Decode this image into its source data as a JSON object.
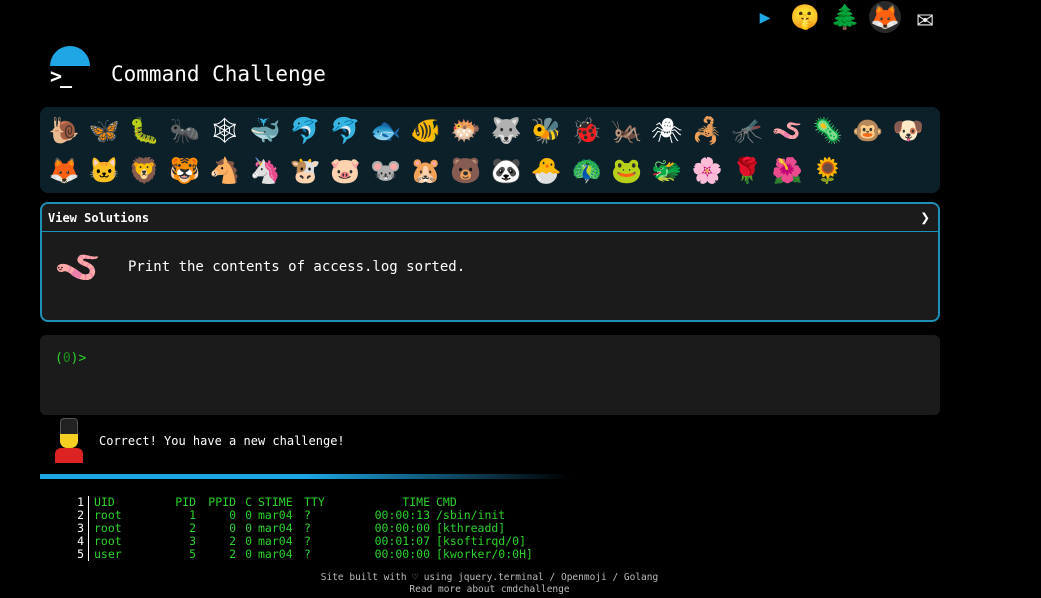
{
  "top_icons": [
    {
      "name": "terminal-logo-icon",
      "glyph": "▶"
    },
    {
      "name": "shushing-face-icon",
      "glyph": "🤫"
    },
    {
      "name": "evergreen-tree-icon",
      "glyph": "🌲"
    },
    {
      "name": "gitlab-icon",
      "glyph": "🦊"
    },
    {
      "name": "envelope-icon",
      "glyph": "✉"
    }
  ],
  "header": {
    "title": "Command Challenge",
    "logo_prompt": ">_"
  },
  "emoji_grid": [
    "🐌",
    "🦋",
    "🐛",
    "🐜",
    "🕸",
    "🐳",
    "🐬",
    "🐬",
    "🐟",
    "🐠",
    "🐡",
    "🐺",
    "🐝",
    "🐞",
    "🦗",
    "🕷",
    "🦂",
    "🦟",
    "🪱",
    "🦠",
    "🐵",
    "🐶",
    "🦊",
    "🐱",
    "🦁",
    "🐯",
    "🐴",
    "🦄",
    "🐮",
    "🐷",
    "🐭",
    "🐹",
    "🐻",
    "🐼",
    "🐣",
    "🦚",
    "🐸",
    "🐲",
    "🌸",
    "🌹",
    "🌺",
    "🌻"
  ],
  "challenge": {
    "header_label": "View Solutions",
    "chevron": "❯",
    "emoji": "🪱",
    "text": "Print the contents of access.log sorted."
  },
  "terminal": {
    "prompt_open": "(",
    "prompt_count": "0",
    "prompt_close": ")>"
  },
  "feedback": {
    "text": "Correct! You have a new challenge!"
  },
  "ps_output": {
    "headers": [
      "UID",
      "PID",
      "PPID",
      "C",
      "STIME",
      "TTY",
      "TIME",
      "CMD"
    ],
    "rows": [
      [
        "root",
        "1",
        "0",
        "0",
        "mar04",
        "?",
        "00:00:13",
        "/sbin/init"
      ],
      [
        "root",
        "2",
        "0",
        "0",
        "mar04",
        "?",
        "00:00:00",
        "[kthreadd]"
      ],
      [
        "root",
        "3",
        "2",
        "0",
        "mar04",
        "?",
        "00:01:07",
        "[ksoftirqd/0]"
      ],
      [
        "user",
        "5",
        "2",
        "0",
        "mar04",
        "?",
        "00:00:00",
        "[kworker/0:0H]"
      ]
    ]
  },
  "footer": {
    "line1": "Site built with ♡ using jquery.terminal / Openmoji / Golang",
    "line2": "Read more about cmdchallenge"
  },
  "colors": {
    "accent": "#1ea7e4",
    "terminal_green": "#2bd32b",
    "panel_bg": "#1b1b1b",
    "grid_bg": "#0b2029"
  }
}
